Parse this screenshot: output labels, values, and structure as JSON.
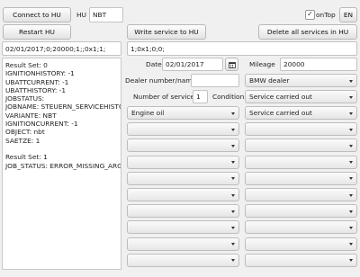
{
  "toolbar": {
    "connect_label": "Connect to HU",
    "hu_label": "HU",
    "hu_value": "NBT",
    "ontop_label": "onTop",
    "ontop_checked": true,
    "lang_label": "EN",
    "restart_label": "Restart HU",
    "write_label": "Write service to HU",
    "delete_label": "Delete all services in HU"
  },
  "data_fields": {
    "left_value": "02/01/2017;0;20000;1;;0x1;1;",
    "right_value": "1;0x1;0;0;"
  },
  "results": {
    "lines": [
      "Result Set: 0",
      "IGNITIONHISTORY: -1",
      "UBATTCURRENT: -1",
      "UBATTHISTORY: -1",
      "JOBSTATUS:",
      "JOBNAME: STEUERN_SERVICEHISTORY_",
      "VARIANTE: NBT",
      "IGNITIONCURRENT: -1",
      "OBJECT: nbt",
      "SAETZE: 1",
      "",
      "Result Set: 1",
      "JOB_STATUS: ERROR_MISSING_ARGUM"
    ]
  },
  "form": {
    "date_label": "Date",
    "date_value": "02/01/2017",
    "calendar_icon": "calendar-icon",
    "mileage_label": "Mileage",
    "mileage_value": "20000",
    "dealer_label": "Dealer number/name",
    "dealer_value": "",
    "dealer_type": "BMW dealer",
    "services_label": "Number of services",
    "services_value": "1",
    "condition_label": "Condition",
    "condition_value": "Service carried out"
  },
  "service_rows": [
    {
      "service": "Engine oil",
      "condition": "Service carried out"
    },
    {
      "service": "",
      "condition": ""
    },
    {
      "service": "",
      "condition": ""
    },
    {
      "service": "",
      "condition": ""
    },
    {
      "service": "",
      "condition": ""
    },
    {
      "service": "",
      "condition": ""
    },
    {
      "service": "",
      "condition": ""
    },
    {
      "service": "",
      "condition": ""
    },
    {
      "service": "",
      "condition": ""
    },
    {
      "service": "",
      "condition": ""
    }
  ]
}
